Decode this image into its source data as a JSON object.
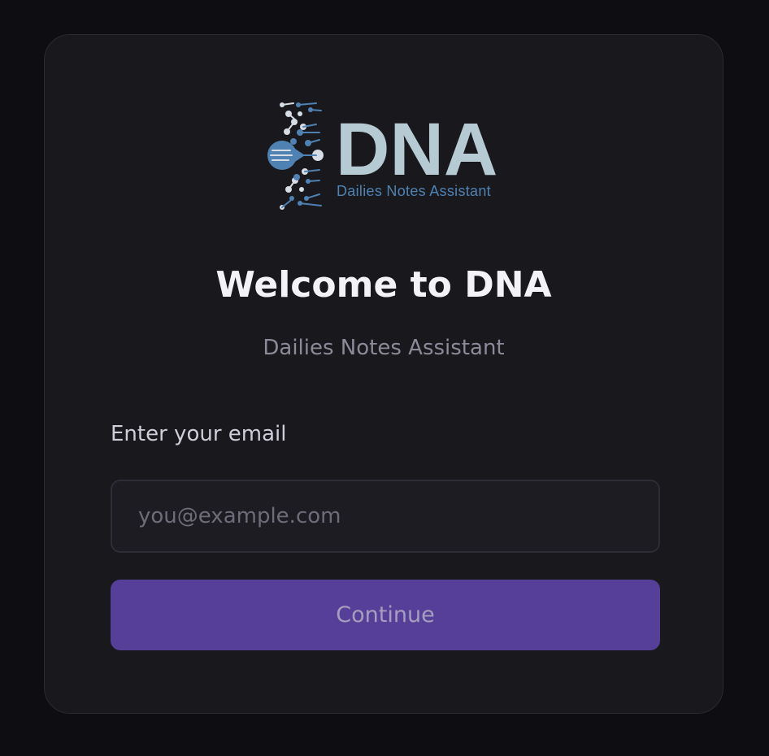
{
  "logo": {
    "wordmark": "DNA",
    "tagline": "Dailies Notes Assistant",
    "wordmark_color": "#b6cad3",
    "tagline_color": "#4f82b3",
    "helix_color": "#4f82b3"
  },
  "title": "Welcome to DNA",
  "subtitle": "Dailies Notes Assistant",
  "form": {
    "email_label": "Enter your email",
    "email_placeholder": "you@example.com",
    "email_value": "",
    "continue_label": "Continue"
  },
  "colors": {
    "background": "#0e0e12",
    "card": "#18181d",
    "primary_button": "#563f99"
  }
}
